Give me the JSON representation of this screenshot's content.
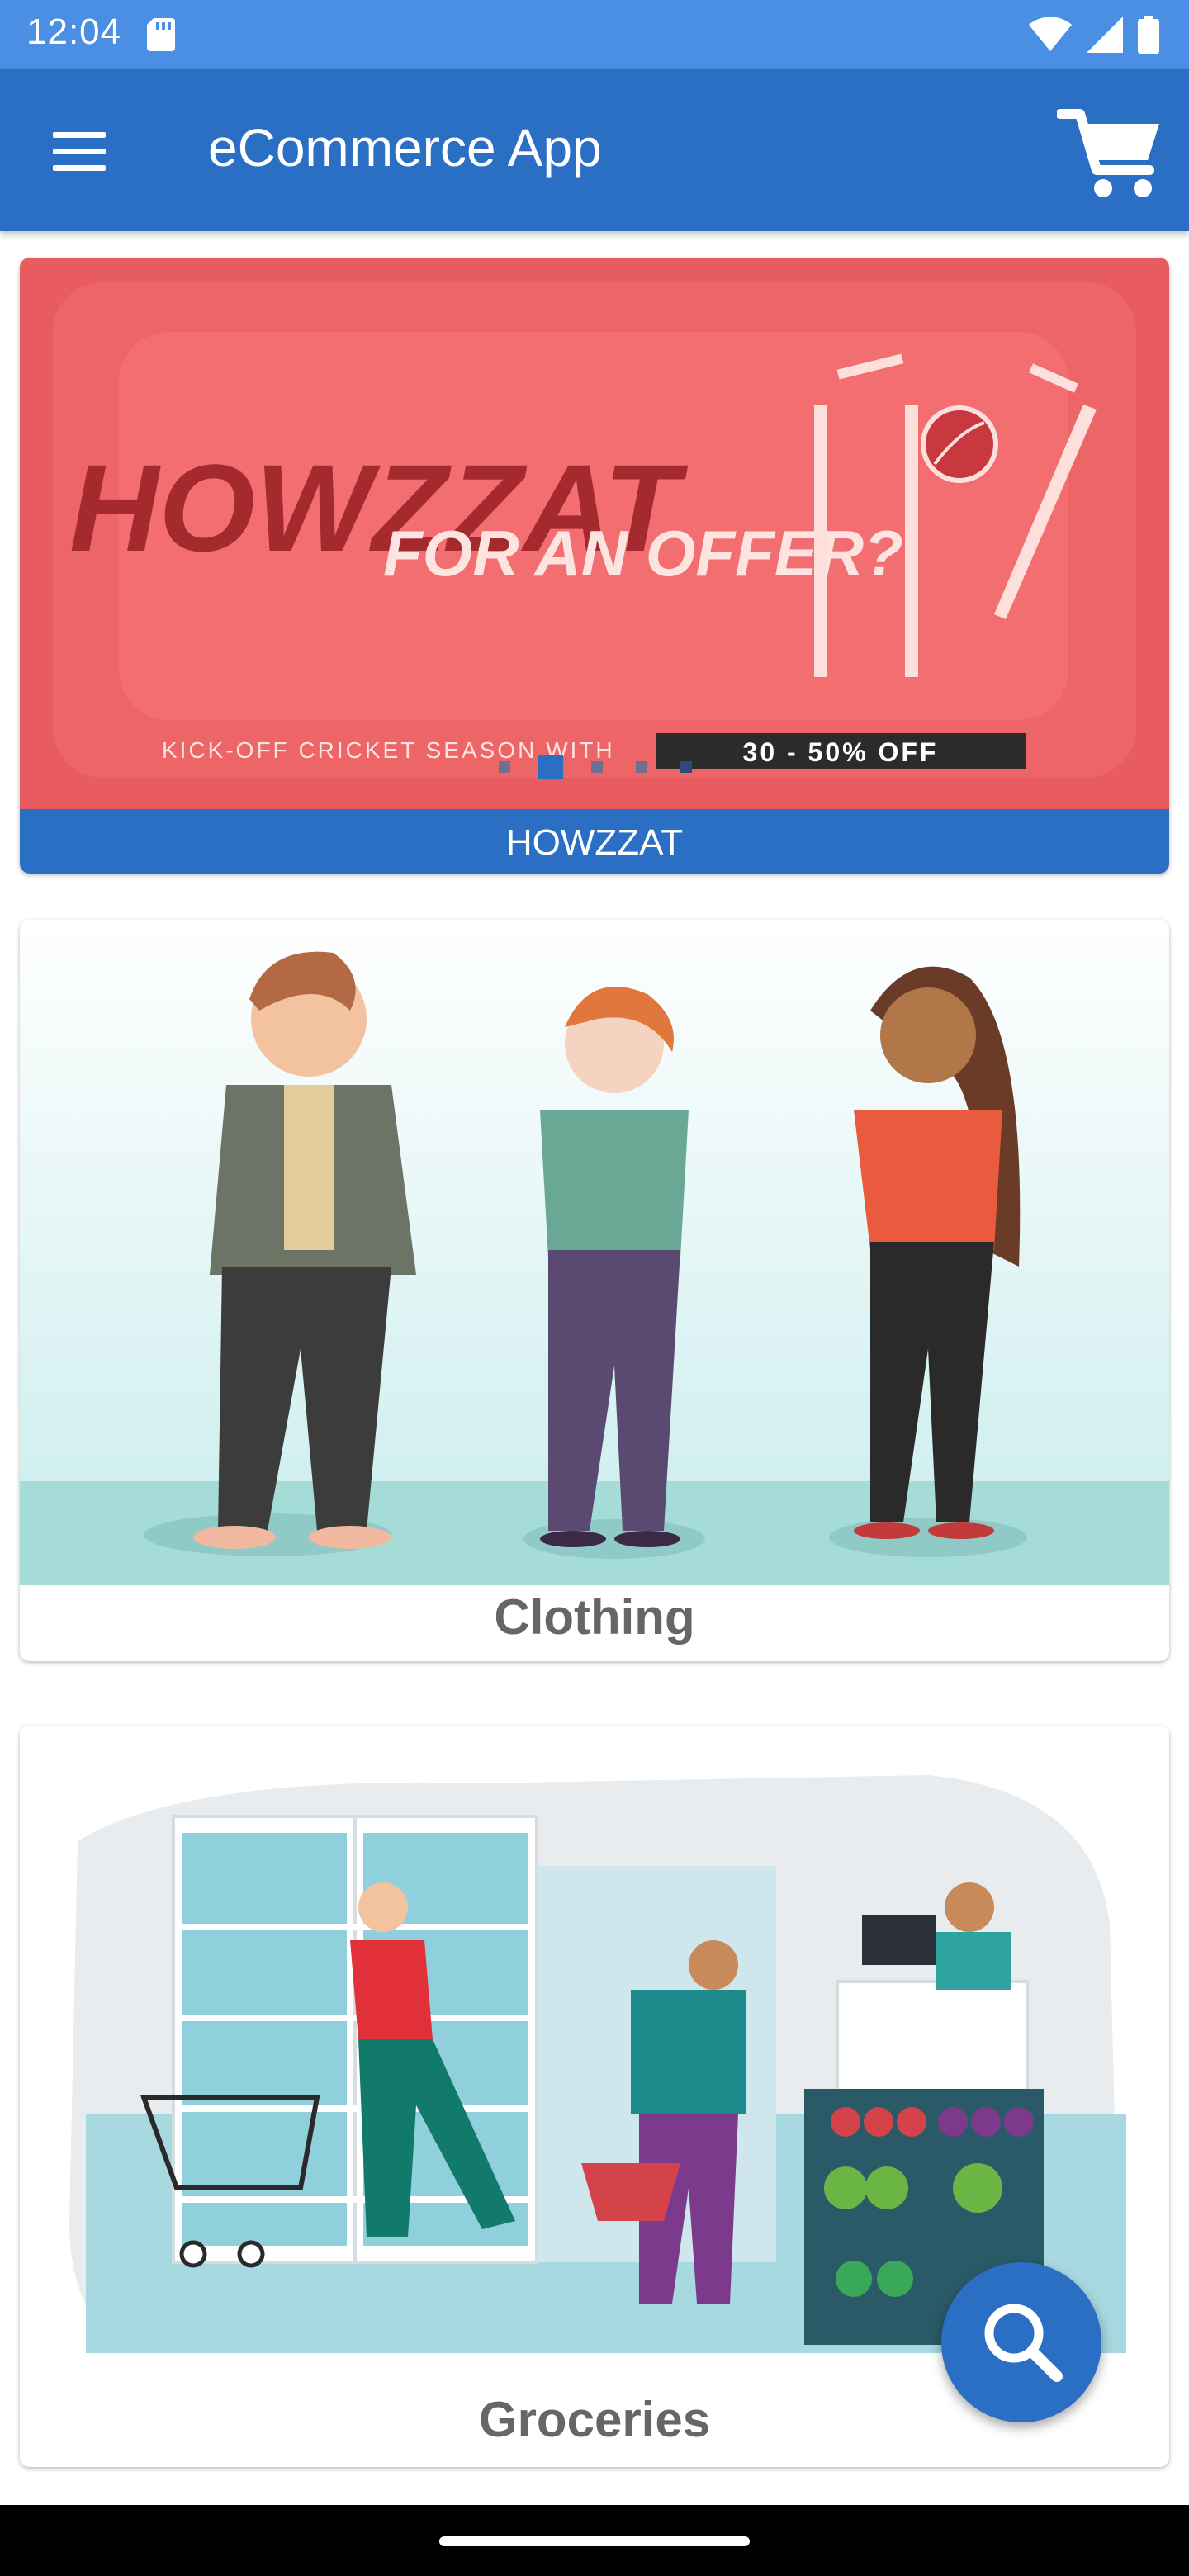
{
  "status_bar": {
    "time": "12:04",
    "icons": [
      "sd-card-icon",
      "wifi-icon",
      "signal-icon",
      "battery-icon"
    ]
  },
  "app_bar": {
    "title": "eCommerce App",
    "menu_icon": "hamburger-menu-icon",
    "cart_icon": "shopping-cart-icon"
  },
  "banner": {
    "caption": "HOWZZAT",
    "image_text": {
      "headline": "HOWZZAT",
      "subline": "FOR AN OFFER?",
      "tagline": "KICK-OFF CRICKET SEASON WITH",
      "offer": "30 - 50% OFF"
    },
    "dots_count": 5,
    "active_dot": 1
  },
  "categories": [
    {
      "label": "Clothing"
    },
    {
      "label": "Groceries"
    }
  ],
  "fab": {
    "icon": "search-icon"
  },
  "colors": {
    "status_bar": "#4a8fe3",
    "primary": "#2a6fc4",
    "banner_bg": "#f06b6f",
    "label_text": "#666666"
  }
}
